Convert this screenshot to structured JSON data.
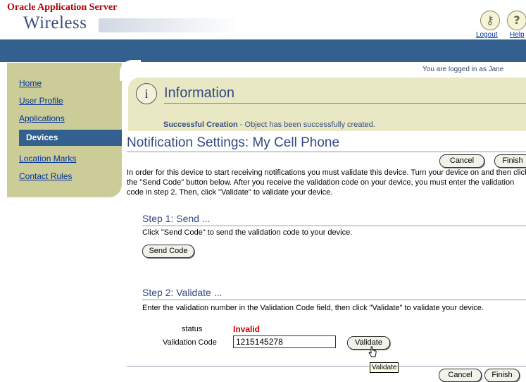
{
  "header": {
    "brand_top": "Oracle Application Server",
    "brand_product": "Wireless",
    "logout_label": "Logout",
    "help_label": "Help",
    "logout_icon": "key-icon",
    "help_icon": "question-icon",
    "logout_glyph": "⚷",
    "help_glyph": "?"
  },
  "user": {
    "logged_in_text": "You are logged in as Jane"
  },
  "sidebar": {
    "items": [
      {
        "label": "Home"
      },
      {
        "label": "User Profile"
      },
      {
        "label": "Applications"
      },
      {
        "label": "Devices",
        "active": true
      },
      {
        "label": "Location Marks"
      },
      {
        "label": "Contact Rules"
      }
    ]
  },
  "info": {
    "icon_glyph": "i",
    "title": "Information",
    "message_strong": "Successful Creation",
    "message_rest": " - Object has been successfully created."
  },
  "page": {
    "title": "Notification Settings: My Cell Phone",
    "intro": "In order for this device to start receiving notifications you must validate this device. Turn your device on and then click the \"Send Code\" button below. After you receive the validation code on your device, you must enter the validation code in step 2. Then, click \"Validate\" to validate your device.",
    "cancel_label": "Cancel",
    "finish_label": "Finish"
  },
  "step1": {
    "title": "Step 1: Send ...",
    "description": "Click \"Send Code\" to send the validation code to your device.",
    "button_label": "Send Code"
  },
  "step2": {
    "title": "Step 2: Validate ...",
    "description": "Enter the validation number in the Validation Code field, then click \"Validate\" to validate your device.",
    "status_label": "status",
    "status_value": "Invalid",
    "code_label": "Validation Code",
    "code_value": "1215145278",
    "button_label": "Validate",
    "tooltip": "Validate"
  },
  "colors": {
    "brand_red": "#b50000",
    "nav_blue": "#33608f",
    "sidebar_tan": "#cccc99",
    "info_bg": "#e8e8c4",
    "status_red": "#cc0000"
  }
}
